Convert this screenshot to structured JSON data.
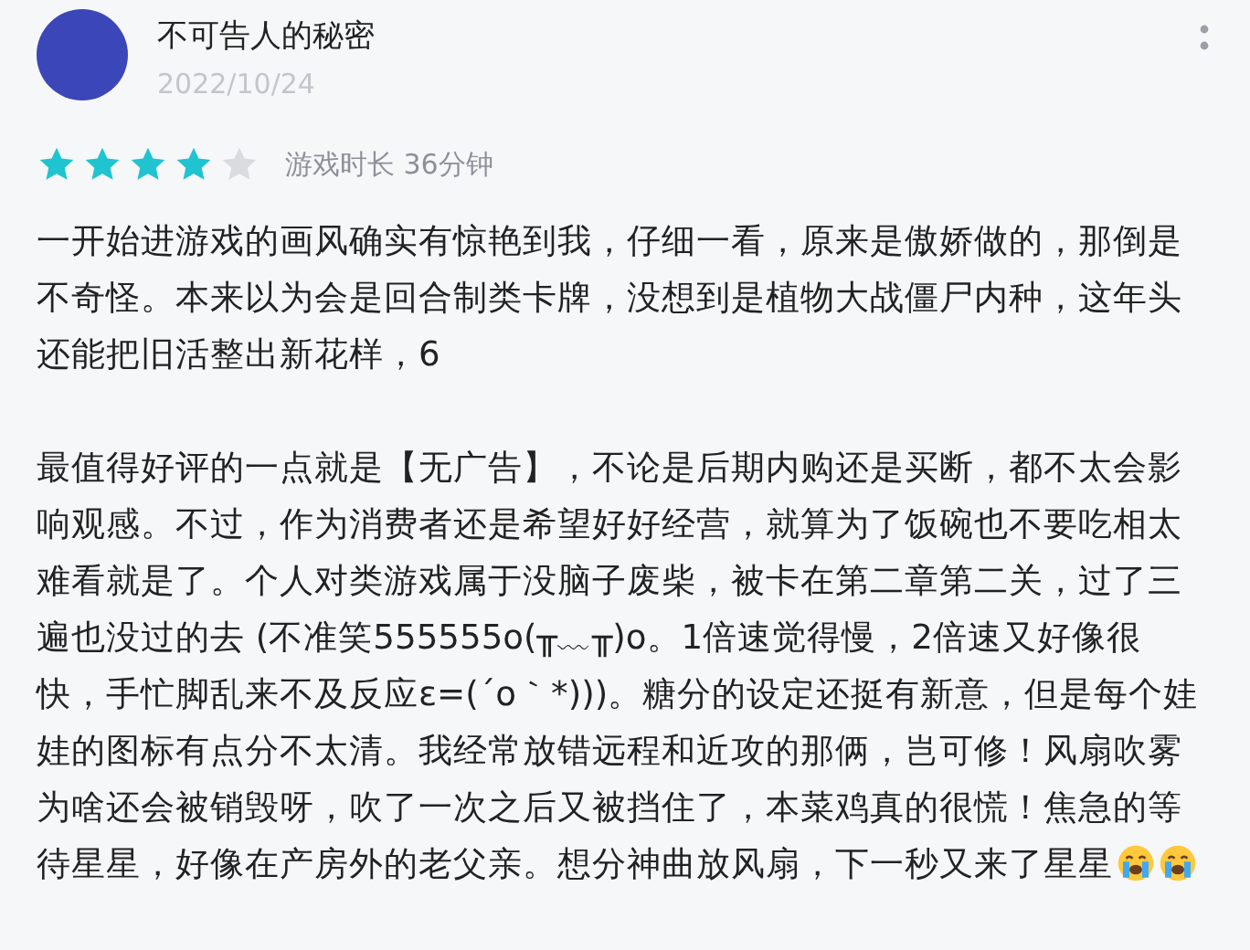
{
  "review": {
    "author": "不可告人的秘密",
    "date": "2022/10/24",
    "stars": 4,
    "playtime": "游戏时长 36分钟",
    "paragraphs": [
      "一开始进游戏的画风确实有惊艳到我，仔细一看，原来是傲娇做的，那倒是不奇怪。本来以为会是回合制类卡牌，没想到是植物大战僵尸内种，这年头还能把旧活整出新花样，6",
      "最值得好评的一点就是【无广告】，不论是后期内购还是买断，都不太会影响观感。不过，作为消费者还是希望好好经营，就算为了饭碗也不要吃相太难看就是了。个人对类游戏属于没脑子废柴，被卡在第二章第二关，过了三遍也没过的去 (不准笑555555o(╥﹏╥)o。1倍速觉得慢，2倍速又好像很快，手忙脚乱来不及反应ε=(´ο｀*)))。糖分的设定还挺有新意，但是每个娃娃的图标有点分不太清。我经常放错远程和近攻的那俩，岂可修！风扇吹雾为啥还会被销毁呀，吹了一次之后又被挡住了，本菜鸡真的很慌！焦急的等待星星，好像在产房外的老父亲。想分神曲放风扇，下一秒又来了星星"
    ]
  }
}
